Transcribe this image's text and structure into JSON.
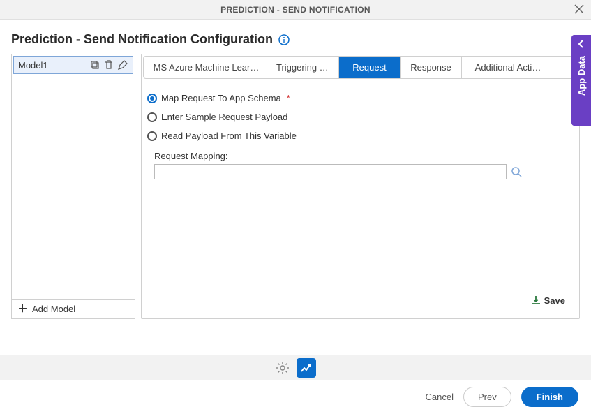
{
  "modal": {
    "header_title": "PREDICTION - SEND NOTIFICATION",
    "page_title": "Prediction - Send Notification Configuration"
  },
  "sidebar": {
    "models": [
      {
        "name": "Model1"
      }
    ],
    "add_label": "Add Model"
  },
  "tabs": [
    {
      "label": "MS Azure Machine Lear…"
    },
    {
      "label": "Triggering Ev…"
    },
    {
      "label": "Request"
    },
    {
      "label": "Response"
    },
    {
      "label": "Additional Acti…"
    }
  ],
  "request_panel": {
    "options": [
      {
        "label": "Map Request To App Schema",
        "required": true,
        "selected": true
      },
      {
        "label": "Enter Sample Request Payload",
        "required": false,
        "selected": false
      },
      {
        "label": "Read Payload From This Variable",
        "required": false,
        "selected": false
      }
    ],
    "mapping_label": "Request Mapping:",
    "mapping_value": "",
    "save_label": "Save"
  },
  "footer": {
    "cancel": "Cancel",
    "prev": "Prev",
    "finish": "Finish"
  },
  "side_panel": {
    "label": "App Data"
  }
}
